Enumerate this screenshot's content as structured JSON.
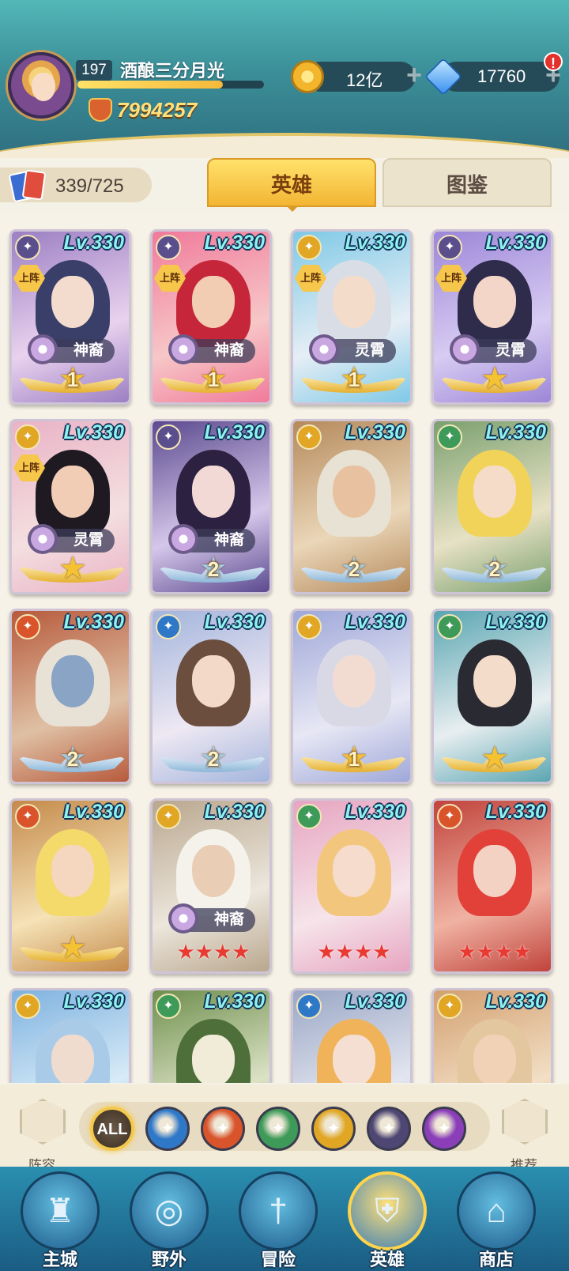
{
  "player": {
    "level": "197",
    "name": "酒酿三分月光",
    "exp_fraction": 0.78,
    "power": "7994257"
  },
  "currency": {
    "gold": "12亿",
    "gems": "17760",
    "alert": "!"
  },
  "collection": {
    "count": "339/725"
  },
  "tabs": {
    "heroes": "英雄",
    "codex": "图鉴"
  },
  "heroes": [
    {
      "level": "Lv.330",
      "faction": "purple",
      "deployed": "上阵",
      "title": "神裔",
      "star_label": "1",
      "star_type": "gold-num",
      "palette": [
        "#9b7fc3",
        "#e9d2ee",
        "#f3dccd",
        "#3a3f6a"
      ]
    },
    {
      "level": "Lv.330",
      "faction": "purple",
      "deployed": "上阵",
      "title": "神裔",
      "star_label": "1",
      "star_type": "gold-num",
      "palette": [
        "#f07a9b",
        "#f7c7c7",
        "#f2cdb3",
        "#c6263a"
      ]
    },
    {
      "level": "Lv.330",
      "faction": "yellow",
      "deployed": "上阵",
      "title": "灵霄",
      "star_label": "1",
      "star_type": "gold-num",
      "palette": [
        "#7fc9e6",
        "#e6eef5",
        "#f4dccb",
        "#d9dde6"
      ]
    },
    {
      "level": "Lv.330",
      "faction": "purple",
      "deployed": "上阵",
      "title": "灵霄",
      "star_label": "",
      "star_type": "gold-star",
      "palette": [
        "#9c86d8",
        "#d7ccf2",
        "#f4d6c9",
        "#2f2b4a"
      ]
    },
    {
      "level": "Lv.330",
      "faction": "yellow",
      "deployed": "上阵",
      "title": "灵霄",
      "star_label": "",
      "star_type": "gold-star",
      "palette": [
        "#e9b3c6",
        "#f4dfe0",
        "#f2cdb6",
        "#1f1a22"
      ]
    },
    {
      "level": "Lv.330",
      "faction": "purple",
      "deployed": "",
      "title": "神裔",
      "star_label": "2",
      "star_type": "blue-num",
      "palette": [
        "#5b4a8f",
        "#d5c7ea",
        "#f3d9d6",
        "#2c2140"
      ]
    },
    {
      "level": "Lv.330",
      "faction": "yellow",
      "deployed": "",
      "title": "",
      "star_label": "2",
      "star_type": "blue-num",
      "palette": [
        "#b58a5c",
        "#ead6b8",
        "#e8c2a0",
        "#e8e2d4"
      ]
    },
    {
      "level": "Lv.330",
      "faction": "green",
      "deployed": "",
      "title": "",
      "star_label": "2",
      "star_type": "blue-num",
      "palette": [
        "#7aa06e",
        "#e7e1c5",
        "#f4dcc8",
        "#f2d35a"
      ]
    },
    {
      "level": "Lv.330",
      "faction": "red",
      "deployed": "",
      "title": "",
      "star_label": "2",
      "star_type": "blue-num",
      "palette": [
        "#b75a3c",
        "#dfc0a4",
        "#8aa4c6",
        "#e8e1d6"
      ]
    },
    {
      "level": "Lv.330",
      "faction": "blue",
      "deployed": "",
      "title": "",
      "star_label": "2",
      "star_type": "blue-num",
      "palette": [
        "#a3b5dc",
        "#eee8f3",
        "#f3d9c8",
        "#6b4e3e"
      ]
    },
    {
      "level": "Lv.330",
      "faction": "yellow",
      "deployed": "",
      "title": "",
      "star_label": "1",
      "star_type": "gold-num",
      "palette": [
        "#9fa8d9",
        "#e7e7f4",
        "#f2dcd2",
        "#d9d9e6"
      ]
    },
    {
      "level": "Lv.330",
      "faction": "green",
      "deployed": "",
      "title": "",
      "star_label": "",
      "star_type": "gold-star",
      "palette": [
        "#5aa6b2",
        "#e8eef0",
        "#f3dcc9",
        "#2a2a33"
      ]
    },
    {
      "level": "Lv.330",
      "faction": "red",
      "deployed": "",
      "title": "",
      "star_label": "",
      "star_type": "gold-star",
      "palette": [
        "#c48a4b",
        "#f5e2b6",
        "#f5d6bf",
        "#f4da6a"
      ]
    },
    {
      "level": "Lv.330",
      "faction": "yellow",
      "deployed": "",
      "title": "神裔",
      "star_label": "★★★★",
      "star_type": "red-stars",
      "palette": [
        "#b9a78e",
        "#ece6dc",
        "#e9cdb5",
        "#f4f2ea"
      ]
    },
    {
      "level": "Lv.330",
      "faction": "green",
      "deployed": "",
      "title": "",
      "star_label": "★★★★",
      "star_type": "red-stars",
      "palette": [
        "#e6a5c0",
        "#f6e4ea",
        "#f6dccd",
        "#f2c77d"
      ]
    },
    {
      "level": "Lv.330",
      "faction": "red",
      "deployed": "",
      "title": "",
      "star_label": "★★★★",
      "star_type": "red-stars",
      "palette": [
        "#c0433c",
        "#f0b2a2",
        "#f3d2c4",
        "#e2413a"
      ]
    },
    {
      "level": "Lv.330",
      "faction": "yellow",
      "deployed": "",
      "title": "",
      "star_label": "",
      "star_type": "none",
      "palette": [
        "#7fb2e0",
        "#d7ebf7",
        "#f0dccf",
        "#a9cbe8"
      ]
    },
    {
      "level": "Lv.330",
      "faction": "green",
      "deployed": "",
      "title": "",
      "star_label": "",
      "star_type": "none",
      "palette": [
        "#6f8f4e",
        "#dbe2c5",
        "#f0ecd8",
        "#4f6f3a"
      ]
    },
    {
      "level": "Lv.330",
      "faction": "blue",
      "deployed": "",
      "title": "",
      "star_label": "",
      "star_type": "none",
      "palette": [
        "#9aa7c6",
        "#e3e6ef",
        "#f5dfd2",
        "#f0b35a"
      ]
    },
    {
      "level": "Lv.330",
      "faction": "yellow",
      "deployed": "",
      "title": "",
      "star_label": "",
      "star_type": "none",
      "palette": [
        "#d3a070",
        "#f2dfc5",
        "#f1d2b7",
        "#e3c79f"
      ]
    }
  ],
  "faction_colors": {
    "purple": "#5b4e8c",
    "yellow": "#e0a624",
    "green": "#3e9a58",
    "red": "#d9542b",
    "blue": "#2f78c8"
  },
  "filter": {
    "lineup_label": "阵容",
    "recommend_label": "推荐",
    "buttons": [
      {
        "name": "all",
        "label": "ALL",
        "color": "#4a3a2c"
      },
      {
        "name": "water",
        "label": "",
        "color": "#2f78c8"
      },
      {
        "name": "fire",
        "label": "",
        "color": "#d9542b"
      },
      {
        "name": "wind",
        "label": "",
        "color": "#3e9a58"
      },
      {
        "name": "light",
        "label": "",
        "color": "#e0a624"
      },
      {
        "name": "shadow",
        "label": "",
        "color": "#4e4673"
      },
      {
        "name": "arcane",
        "label": "",
        "color": "#8a3fb8"
      }
    ]
  },
  "nav": [
    {
      "label": "主城",
      "icon": "castle-icon",
      "glyph": "♜"
    },
    {
      "label": "野外",
      "icon": "wild-icon",
      "glyph": "◎"
    },
    {
      "label": "冒险",
      "icon": "sword-icon",
      "glyph": "†"
    },
    {
      "label": "英雄",
      "icon": "helmet-icon",
      "glyph": "⛨"
    },
    {
      "label": "商店",
      "icon": "shop-icon",
      "glyph": "⌂"
    }
  ]
}
